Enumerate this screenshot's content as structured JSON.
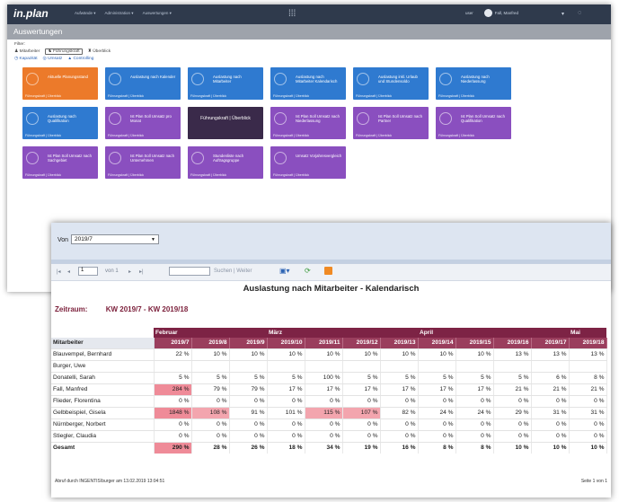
{
  "app": {
    "logo": "in.plan",
    "nav": [
      "Aufwände ▾",
      "Administration ▾",
      "Auswertungen ▾"
    ],
    "user_name": "Fall, Manfred",
    "user_prefix": "user",
    "section_title": "Auswertungen"
  },
  "filters": {
    "label": "Filter:",
    "row1": [
      "Mitarbeiter",
      "Führungskraft",
      "Überblick"
    ],
    "row2": [
      "Kapazität",
      "Umsatz",
      "Controlling"
    ]
  },
  "tiles": [
    {
      "title": "Aktuelle Planungsstand",
      "color": "#ec7a2a",
      "footer": "Führungskraft | Überblick"
    },
    {
      "title": "Auslastung nach Kalender",
      "color": "#2f7ad0",
      "footer": "Führungskraft | Überblick"
    },
    {
      "title": "Auslastung nach Mitarbeiter",
      "color": "#2f7ad0",
      "footer": "Führungskraft | Überblick"
    },
    {
      "title": "Auslastung nach Mitarbeiter Kalendarisch",
      "color": "#2f7ad0",
      "footer": "Führungskraft | Überblick"
    },
    {
      "title": "Auslastung inkl. Urlaub und Stundensoldo",
      "color": "#2f7ad0",
      "footer": "Führungskraft | Überblick"
    },
    {
      "title": "Auslastung nach Niederlassung",
      "color": "#2f7ad0",
      "footer": "Führungskraft | Überblick"
    },
    {
      "title": "Auslastung nach Qualifikation",
      "color": "#2f7ad0",
      "footer": "Führungskraft | Überblick"
    },
    {
      "title": "Ist Plan Soll Umsatz pro Monat",
      "color": "#8a4fbf",
      "footer": "Führungskraft | Überblick"
    },
    {
      "title": "Führungskraft | Überblick",
      "color": "#3a2a4a",
      "dark": true,
      "footer": "Führungskraft | Überblick"
    },
    {
      "title": "Ist Plan Soll Umsatz nach Niederlassung",
      "color": "#8a4fbf",
      "footer": "Führungskraft | Überblick"
    },
    {
      "title": "Ist Plan Soll Umsatz nach Partner",
      "color": "#8a4fbf",
      "footer": "Führungskraft | Überblick"
    },
    {
      "title": "Ist Plan Soll Umsatz nach Qualifikation",
      "color": "#8a4fbf",
      "footer": "Führungskraft | Überblick"
    },
    {
      "title": "Ist Plan Soll Umsatz nach Sachgebiet",
      "color": "#8a4fbf",
      "footer": "Führungskraft | Überblick"
    },
    {
      "title": "Ist Plan Soll Umsatz nach Unternehmen",
      "color": "#8a4fbf",
      "footer": "Führungskraft | Überblick"
    },
    {
      "title": "Stundenliste nach Auftragsgruppe",
      "color": "#8a4fbf",
      "footer": "Führungskraft | Überblick"
    },
    {
      "title": "Umsatz Vorjahresvergleich",
      "color": "#8a4fbf",
      "footer": "Führungskraft | Überblick"
    }
  ],
  "report": {
    "period_label": "Von",
    "period_value": "2019/7",
    "toolbar": {
      "first": "|◂",
      "prev": "◂",
      "page": "1",
      "of": "von 1",
      "next": "▸",
      "last": "▸|",
      "search_placeholder": "",
      "find": "Suchen | Weiter"
    },
    "title": "Auslastung nach Mitarbeiter - Kalendarisch",
    "zeitraum_label": "Zeitraum:",
    "zeitraum_value": "KW 2019/7 - KW 2019/18",
    "months": [
      {
        "label": "Februar",
        "span": 3
      },
      {
        "label": "März",
        "span": 4
      },
      {
        "label": "April",
        "span": 4
      },
      {
        "label": "Mai",
        "span": 1
      }
    ],
    "column_header": "Mitarbeiter",
    "weeks": [
      "2019/7",
      "2019/8",
      "2019/9",
      "2019/10",
      "2019/11",
      "2019/12",
      "2019/13",
      "2019/14",
      "2019/15",
      "2019/16",
      "2019/17",
      "2019/18"
    ],
    "rows": [
      {
        "name": "Blauvempel, Bernhard",
        "values": [
          "22 %",
          "10 %",
          "10 %",
          "10 %",
          "10 %",
          "10 %",
          "10 %",
          "10 %",
          "10 %",
          "13 %",
          "13 %",
          "13 %"
        ],
        "hl": []
      },
      {
        "name": "Burger, Uwe",
        "values": [
          "",
          "",
          "",
          "",
          "",
          "",
          "",
          "",
          "",
          "",
          "",
          ""
        ],
        "hl": []
      },
      {
        "name": "Donatelli, Sarah",
        "values": [
          "5 %",
          "5 %",
          "5 %",
          "5 %",
          "100 %",
          "5 %",
          "5 %",
          "5 %",
          "5 %",
          "5 %",
          "6 %",
          "8 %"
        ],
        "hl": []
      },
      {
        "name": "Fall, Manfred",
        "values": [
          "284 %",
          "79 %",
          "79 %",
          "17 %",
          "17 %",
          "17 %",
          "17 %",
          "17 %",
          "17 %",
          "21 %",
          "21 %",
          "21 %"
        ],
        "hl": [
          0
        ]
      },
      {
        "name": "Flieder, Florentina",
        "values": [
          "0 %",
          "0 %",
          "0 %",
          "0 %",
          "0 %",
          "0 %",
          "0 %",
          "0 %",
          "0 %",
          "0 %",
          "0 %",
          "0 %"
        ],
        "hl": []
      },
      {
        "name": "Gelbbeispiel, Gisela",
        "values": [
          "1848 %",
          "108 %",
          "91 %",
          "101 %",
          "115 %",
          "107 %",
          "82 %",
          "24 %",
          "24 %",
          "29 %",
          "31 %",
          "31 %"
        ],
        "hl": [
          0,
          1,
          4,
          5
        ]
      },
      {
        "name": "Nürnberger, Norbert",
        "values": [
          "0 %",
          "0 %",
          "0 %",
          "0 %",
          "0 %",
          "0 %",
          "0 %",
          "0 %",
          "0 %",
          "0 %",
          "0 %",
          "0 %"
        ],
        "hl": []
      },
      {
        "name": "Stiegler, Claudia",
        "values": [
          "0 %",
          "0 %",
          "0 %",
          "0 %",
          "0 %",
          "0 %",
          "0 %",
          "0 %",
          "0 %",
          "0 %",
          "0 %",
          "0 %"
        ],
        "hl": []
      }
    ],
    "total": {
      "name": "Gesamt",
      "values": [
        "290 %",
        "28 %",
        "26 %",
        "18 %",
        "34 %",
        "19 %",
        "16 %",
        "8 %",
        "8 %",
        "10 %",
        "10 %",
        "10 %"
      ],
      "hl": [
        0
      ]
    },
    "footer_left": "Abruf durch INGENTIS\\burger am 13.02.2019 13:04:51",
    "footer_right": "Seite 1 von 1"
  }
}
